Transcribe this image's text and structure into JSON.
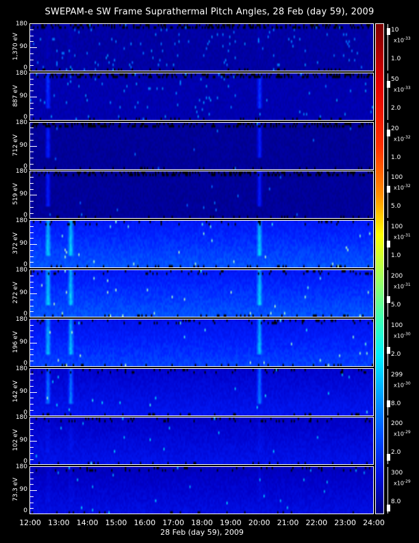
{
  "chart_data": {
    "type": "heatmap",
    "title": "SWEPAM-e SW Frame Suprathermal Pitch Angles, 28 Feb (day  59), 2009",
    "xlabel": "28 Feb (day  59), 2009",
    "x_ticks": [
      "12:00",
      "13:00",
      "14:00",
      "15:00",
      "16:00",
      "17:00",
      "18:00",
      "19:00",
      "20:00",
      "21:00",
      "22:00",
      "23:00",
      "24:00"
    ],
    "xlim": [
      "12:00",
      "24:00"
    ],
    "ylim": [
      0,
      180
    ],
    "y_ticks": [
      "0",
      "90",
      "180"
    ],
    "panels": [
      {
        "energy": "1,370 eV",
        "level": 0.15,
        "speckle": 0.5,
        "cb_top": "10",
        "cb_mult": "x10",
        "cb_exp": "-33",
        "cb_bottom": "1.0",
        "cb_mark": 0.9
      },
      {
        "energy": "887 eV",
        "level": 0.18,
        "speckle": 0.3,
        "cb_top": "50",
        "cb_mult": "x10",
        "cb_exp": "-33",
        "cb_bottom": "2.0",
        "cb_mark": 0.8
      },
      {
        "energy": "712 eV",
        "level": 0.12,
        "speckle": 0.05,
        "cb_top": "20",
        "cb_mult": "x10",
        "cb_exp": "-32",
        "cb_bottom": "1.0",
        "cb_mark": 0.82
      },
      {
        "energy": "519 eV",
        "level": 0.12,
        "speckle": 0.05,
        "cb_top": "100",
        "cb_mult": "x10",
        "cb_exp": "-32",
        "cb_bottom": "5.0",
        "cb_mark": 0.65
      },
      {
        "energy": "372 eV",
        "level": 0.42,
        "speckle": 0.1,
        "cb_top": "100",
        "cb_mult": "x10",
        "cb_exp": "-31",
        "cb_bottom": "1.0",
        "cb_mark": 0.5
      },
      {
        "energy": "272 eV",
        "level": 0.42,
        "speckle": 0.1,
        "cb_top": "200",
        "cb_mult": "x10",
        "cb_exp": "-31",
        "cb_bottom": "5.0",
        "cb_mark": 0.35
      },
      {
        "energy": "196 eV",
        "level": 0.38,
        "speckle": 0.1,
        "cb_top": "100",
        "cb_mult": "x10",
        "cb_exp": "-30",
        "cb_bottom": "2.0",
        "cb_mark": 0.3
      },
      {
        "energy": "142 eV",
        "level": 0.27,
        "speckle": 0.08,
        "cb_top": "299",
        "cb_mult": "x10",
        "cb_exp": "-30",
        "cb_bottom": "8.0",
        "cb_mark": 0.2
      },
      {
        "energy": "102 eV",
        "level": 0.25,
        "speckle": 0.08,
        "cb_top": "200",
        "cb_mult": "x10",
        "cb_exp": "-29",
        "cb_bottom": "2.0",
        "cb_mark": 0.1
      },
      {
        "energy": "73.3 eV",
        "level": 0.22,
        "speckle": 0.08,
        "cb_top": "300",
        "cb_mult": "x10",
        "cb_exp": "-29",
        "cb_bottom": "8.0",
        "cb_mark": 0.05
      }
    ],
    "features": [
      {
        "time_hours": 12.6,
        "note": "burst"
      },
      {
        "time_hours": 13.4,
        "note": "burst"
      },
      {
        "time_hours": 20.0,
        "note": "burst"
      }
    ]
  }
}
